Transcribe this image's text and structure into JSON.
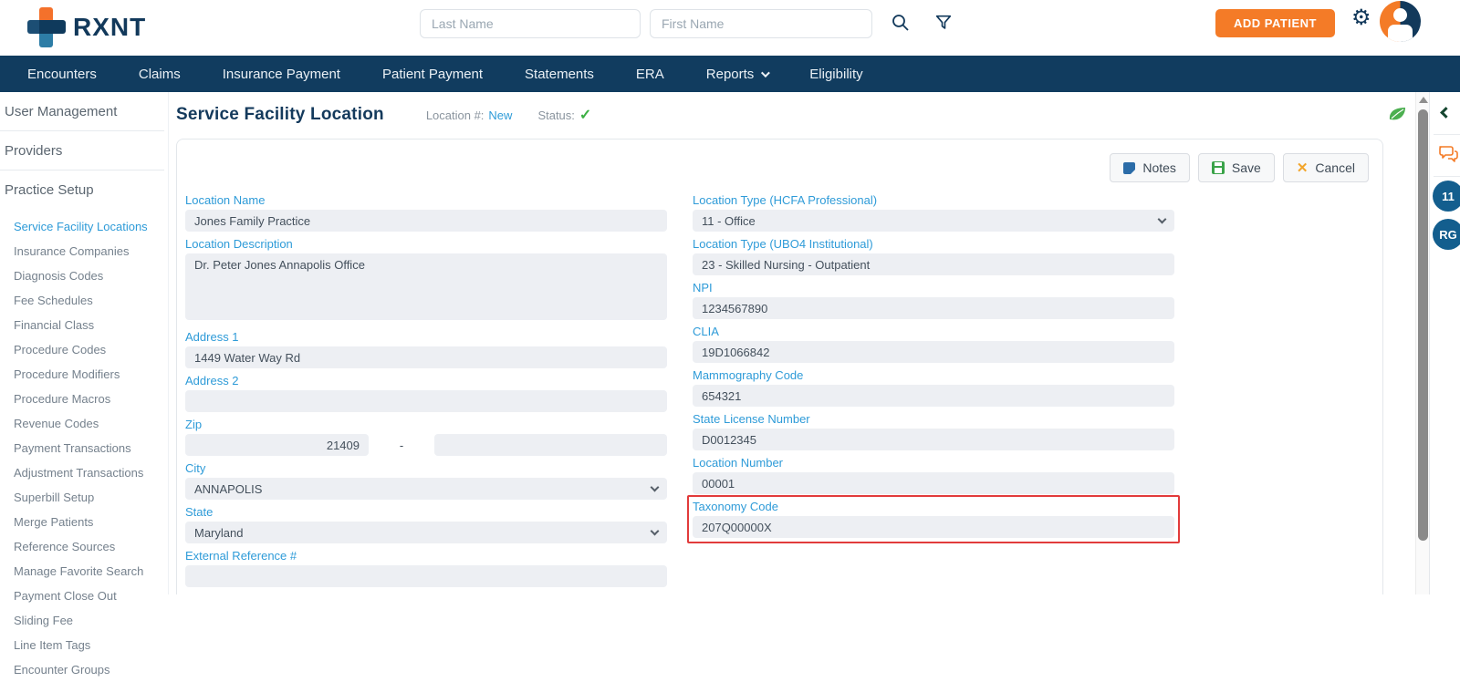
{
  "header": {
    "logo_text": "RXNT",
    "last_name_placeholder": "Last Name",
    "first_name_placeholder": "First Name",
    "add_patient_label": "ADD PATIENT"
  },
  "nav": {
    "items": [
      "Encounters",
      "Claims",
      "Insurance Payment",
      "Patient Payment",
      "Statements",
      "ERA",
      "Reports",
      "Eligibility"
    ]
  },
  "sidebar": {
    "top_items": [
      "User Management",
      "Providers"
    ],
    "section_label": "Practice Setup",
    "active_item": "Service Facility Locations",
    "items": [
      "Service Facility Locations",
      "Insurance Companies",
      "Diagnosis Codes",
      "Fee Schedules",
      "Financial Class",
      "Procedure Codes",
      "Procedure Modifiers",
      "Procedure Macros",
      "Revenue Codes",
      "Payment Transactions",
      "Adjustment Transactions",
      "Superbill Setup",
      "Merge Patients",
      "Reference Sources",
      "Manage Favorite Search",
      "Payment Close Out",
      "Sliding Fee",
      "Line Item Tags",
      "Encounter Groups"
    ]
  },
  "page": {
    "title": "Service Facility Location",
    "location_number_label": "Location #:",
    "location_number_value": "New",
    "status_label": "Status:",
    "status_check": "✓"
  },
  "toolbar": {
    "notes_label": "Notes",
    "save_label": "Save",
    "cancel_label": "Cancel",
    "cancel_icon": "✕"
  },
  "form": {
    "left": [
      {
        "label": "Location Name",
        "value": "Jones Family Practice",
        "type": "text"
      },
      {
        "label": "Location Description",
        "value": "Dr. Peter Jones Annapolis Office",
        "type": "textarea"
      },
      {
        "label": "Address 1",
        "value": "1449 Water Way Rd",
        "type": "text"
      },
      {
        "label": "Address 2",
        "value": "",
        "type": "text"
      },
      {
        "label": "Zip",
        "value": "21409",
        "value2": "",
        "separator": "-",
        "type": "zip"
      },
      {
        "label": "City",
        "value": "ANNAPOLIS",
        "type": "select"
      },
      {
        "label": "State",
        "value": "Maryland",
        "type": "select"
      },
      {
        "label": "External Reference #",
        "value": "",
        "type": "text"
      }
    ],
    "right": [
      {
        "label": "Location Type (HCFA Professional)",
        "value": "11 - Office",
        "type": "select"
      },
      {
        "label": "Location Type (UBO4 Institutional)",
        "value": "23 - Skilled Nursing - Outpatient",
        "type": "text"
      },
      {
        "label": "NPI",
        "value": "1234567890",
        "type": "text"
      },
      {
        "label": "CLIA",
        "value": "19D1066842",
        "type": "text"
      },
      {
        "label": "Mammography Code",
        "value": "654321",
        "type": "text"
      },
      {
        "label": "State License Number",
        "value": "D0012345",
        "type": "text"
      },
      {
        "label": "Location Number",
        "value": "00001",
        "type": "text"
      },
      {
        "label": "Taxonomy Code",
        "value": "207Q00000X",
        "type": "text",
        "highlighted": true
      }
    ]
  },
  "right_rail": {
    "badges": [
      "11",
      "RG"
    ]
  },
  "icons": [
    "rxnt-logo",
    "search-icon",
    "filter-icon",
    "gear-icon",
    "avatar",
    "notes-icon",
    "save-icon",
    "cancel-icon",
    "status-check-icon",
    "leaf-icon",
    "chat-icon",
    "collapse-chevron-icon"
  ],
  "colors": {
    "navy": "#113C5F",
    "orange": "#F47B27",
    "label_blue": "#2E9BD8",
    "green_check": "#3CB043",
    "red_highlight": "#E23B3B",
    "badge_blue": "#135E8E",
    "field_bg": "#EDEFF3"
  }
}
